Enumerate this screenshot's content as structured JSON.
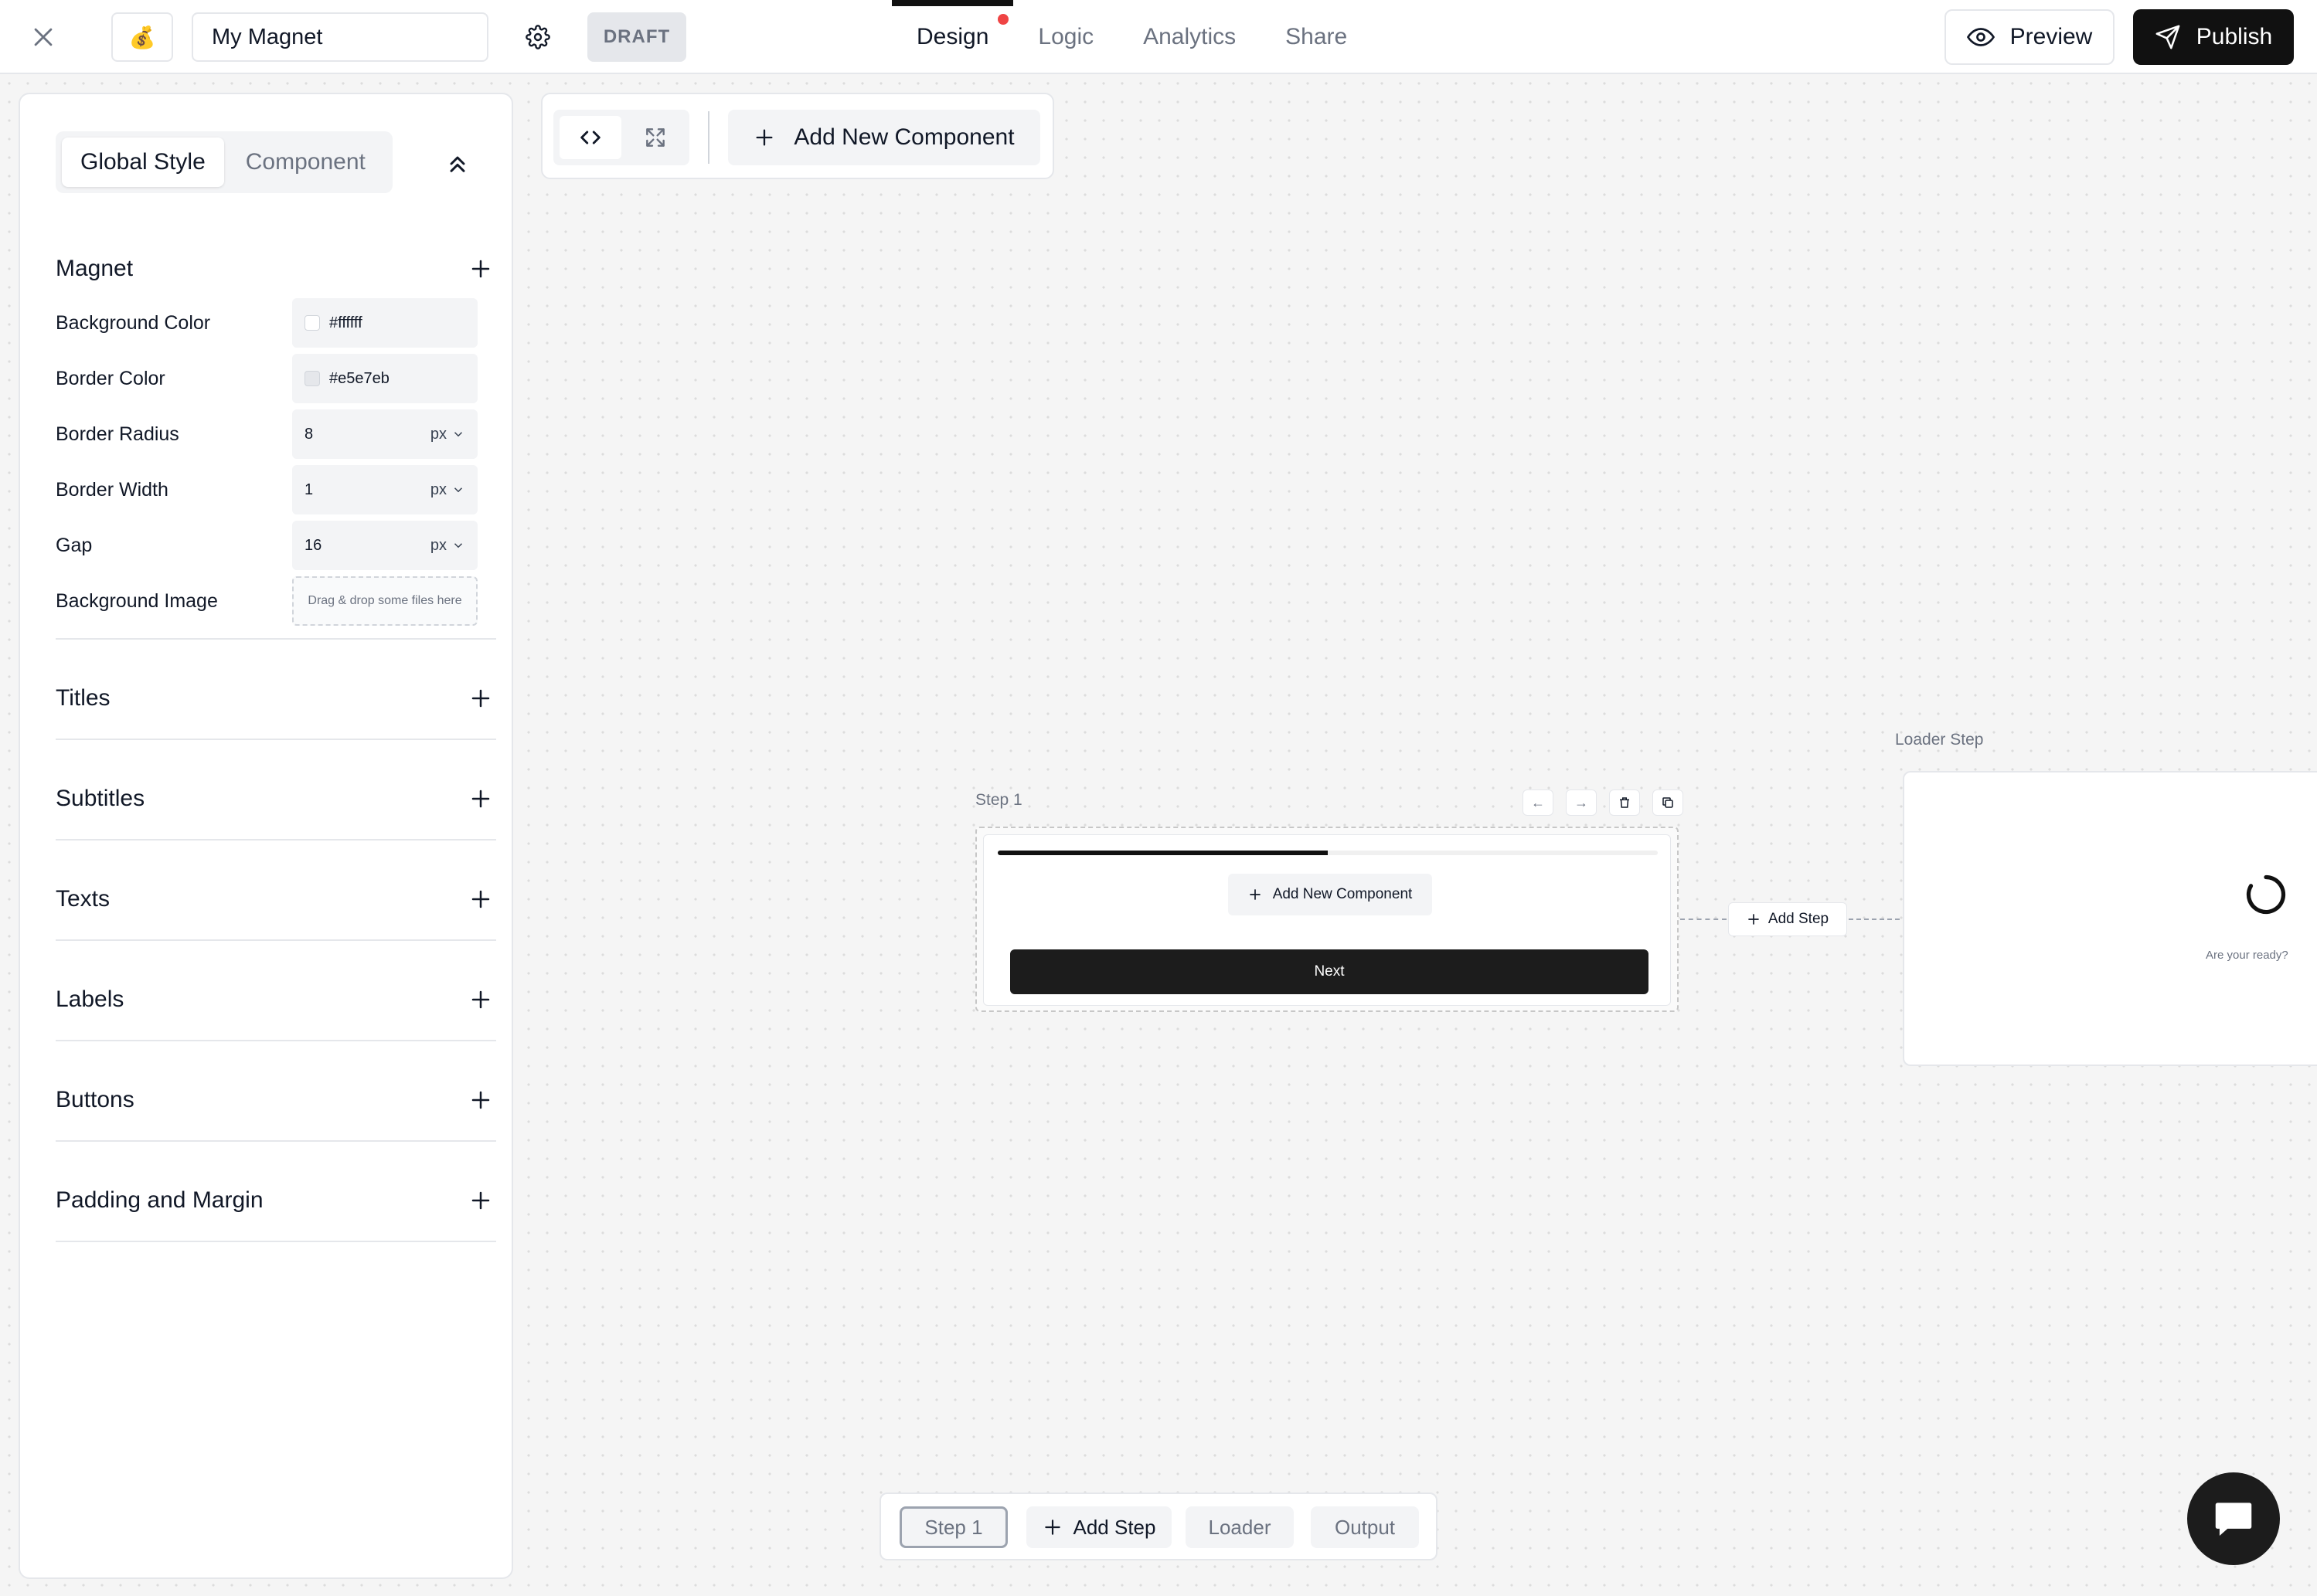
{
  "header": {
    "logo_emoji": "💰",
    "title_value": "My Magnet",
    "draft_label": "DRAFT",
    "tabs": [
      {
        "label": "Design",
        "active": true,
        "has_dot": true
      },
      {
        "label": "Logic",
        "active": false
      },
      {
        "label": "Analytics",
        "active": false
      },
      {
        "label": "Share",
        "active": false
      }
    ],
    "preview_label": "Preview",
    "publish_label": "Publish"
  },
  "sidebar": {
    "segment": {
      "global_style": "Global Style",
      "component": "Component",
      "active": "global_style"
    },
    "magnet": {
      "title": "Magnet",
      "properties": {
        "background_color": {
          "label": "Background Color",
          "value": "#ffffff",
          "swatch": "#ffffff"
        },
        "border_color": {
          "label": "Border Color",
          "value": "#e5e7eb",
          "swatch": "#e5e7eb"
        },
        "border_radius": {
          "label": "Border Radius",
          "value": "8",
          "unit": "px"
        },
        "border_width": {
          "label": "Border Width",
          "value": "1",
          "unit": "px"
        },
        "gap": {
          "label": "Gap",
          "value": "16",
          "unit": "px"
        },
        "background_image": {
          "label": "Background Image",
          "placeholder": "Drag & drop some files here"
        }
      }
    },
    "sections": [
      {
        "label": "Titles"
      },
      {
        "label": "Subtitles"
      },
      {
        "label": "Texts"
      },
      {
        "label": "Labels"
      },
      {
        "label": "Buttons"
      },
      {
        "label": "Padding and Margin"
      }
    ]
  },
  "toolbar": {
    "add_component_label": "Add New Component"
  },
  "canvas": {
    "step1": {
      "label": "Step 1",
      "progress": 0.5,
      "add_component_label": "Add New Component",
      "next_label": "Next",
      "controls": {
        "left": "←",
        "right": "→"
      }
    },
    "add_step_label": "Add Step",
    "loader": {
      "label": "Loader Step",
      "text": "Are your ready?"
    }
  },
  "stepbar": {
    "step1": "Step 1",
    "add_step": "Add Step",
    "loader": "Loader",
    "output": "Output"
  },
  "colors": {
    "accent": "#111111",
    "notification_dot": "#ef4444",
    "border": "#e5e7eb"
  }
}
